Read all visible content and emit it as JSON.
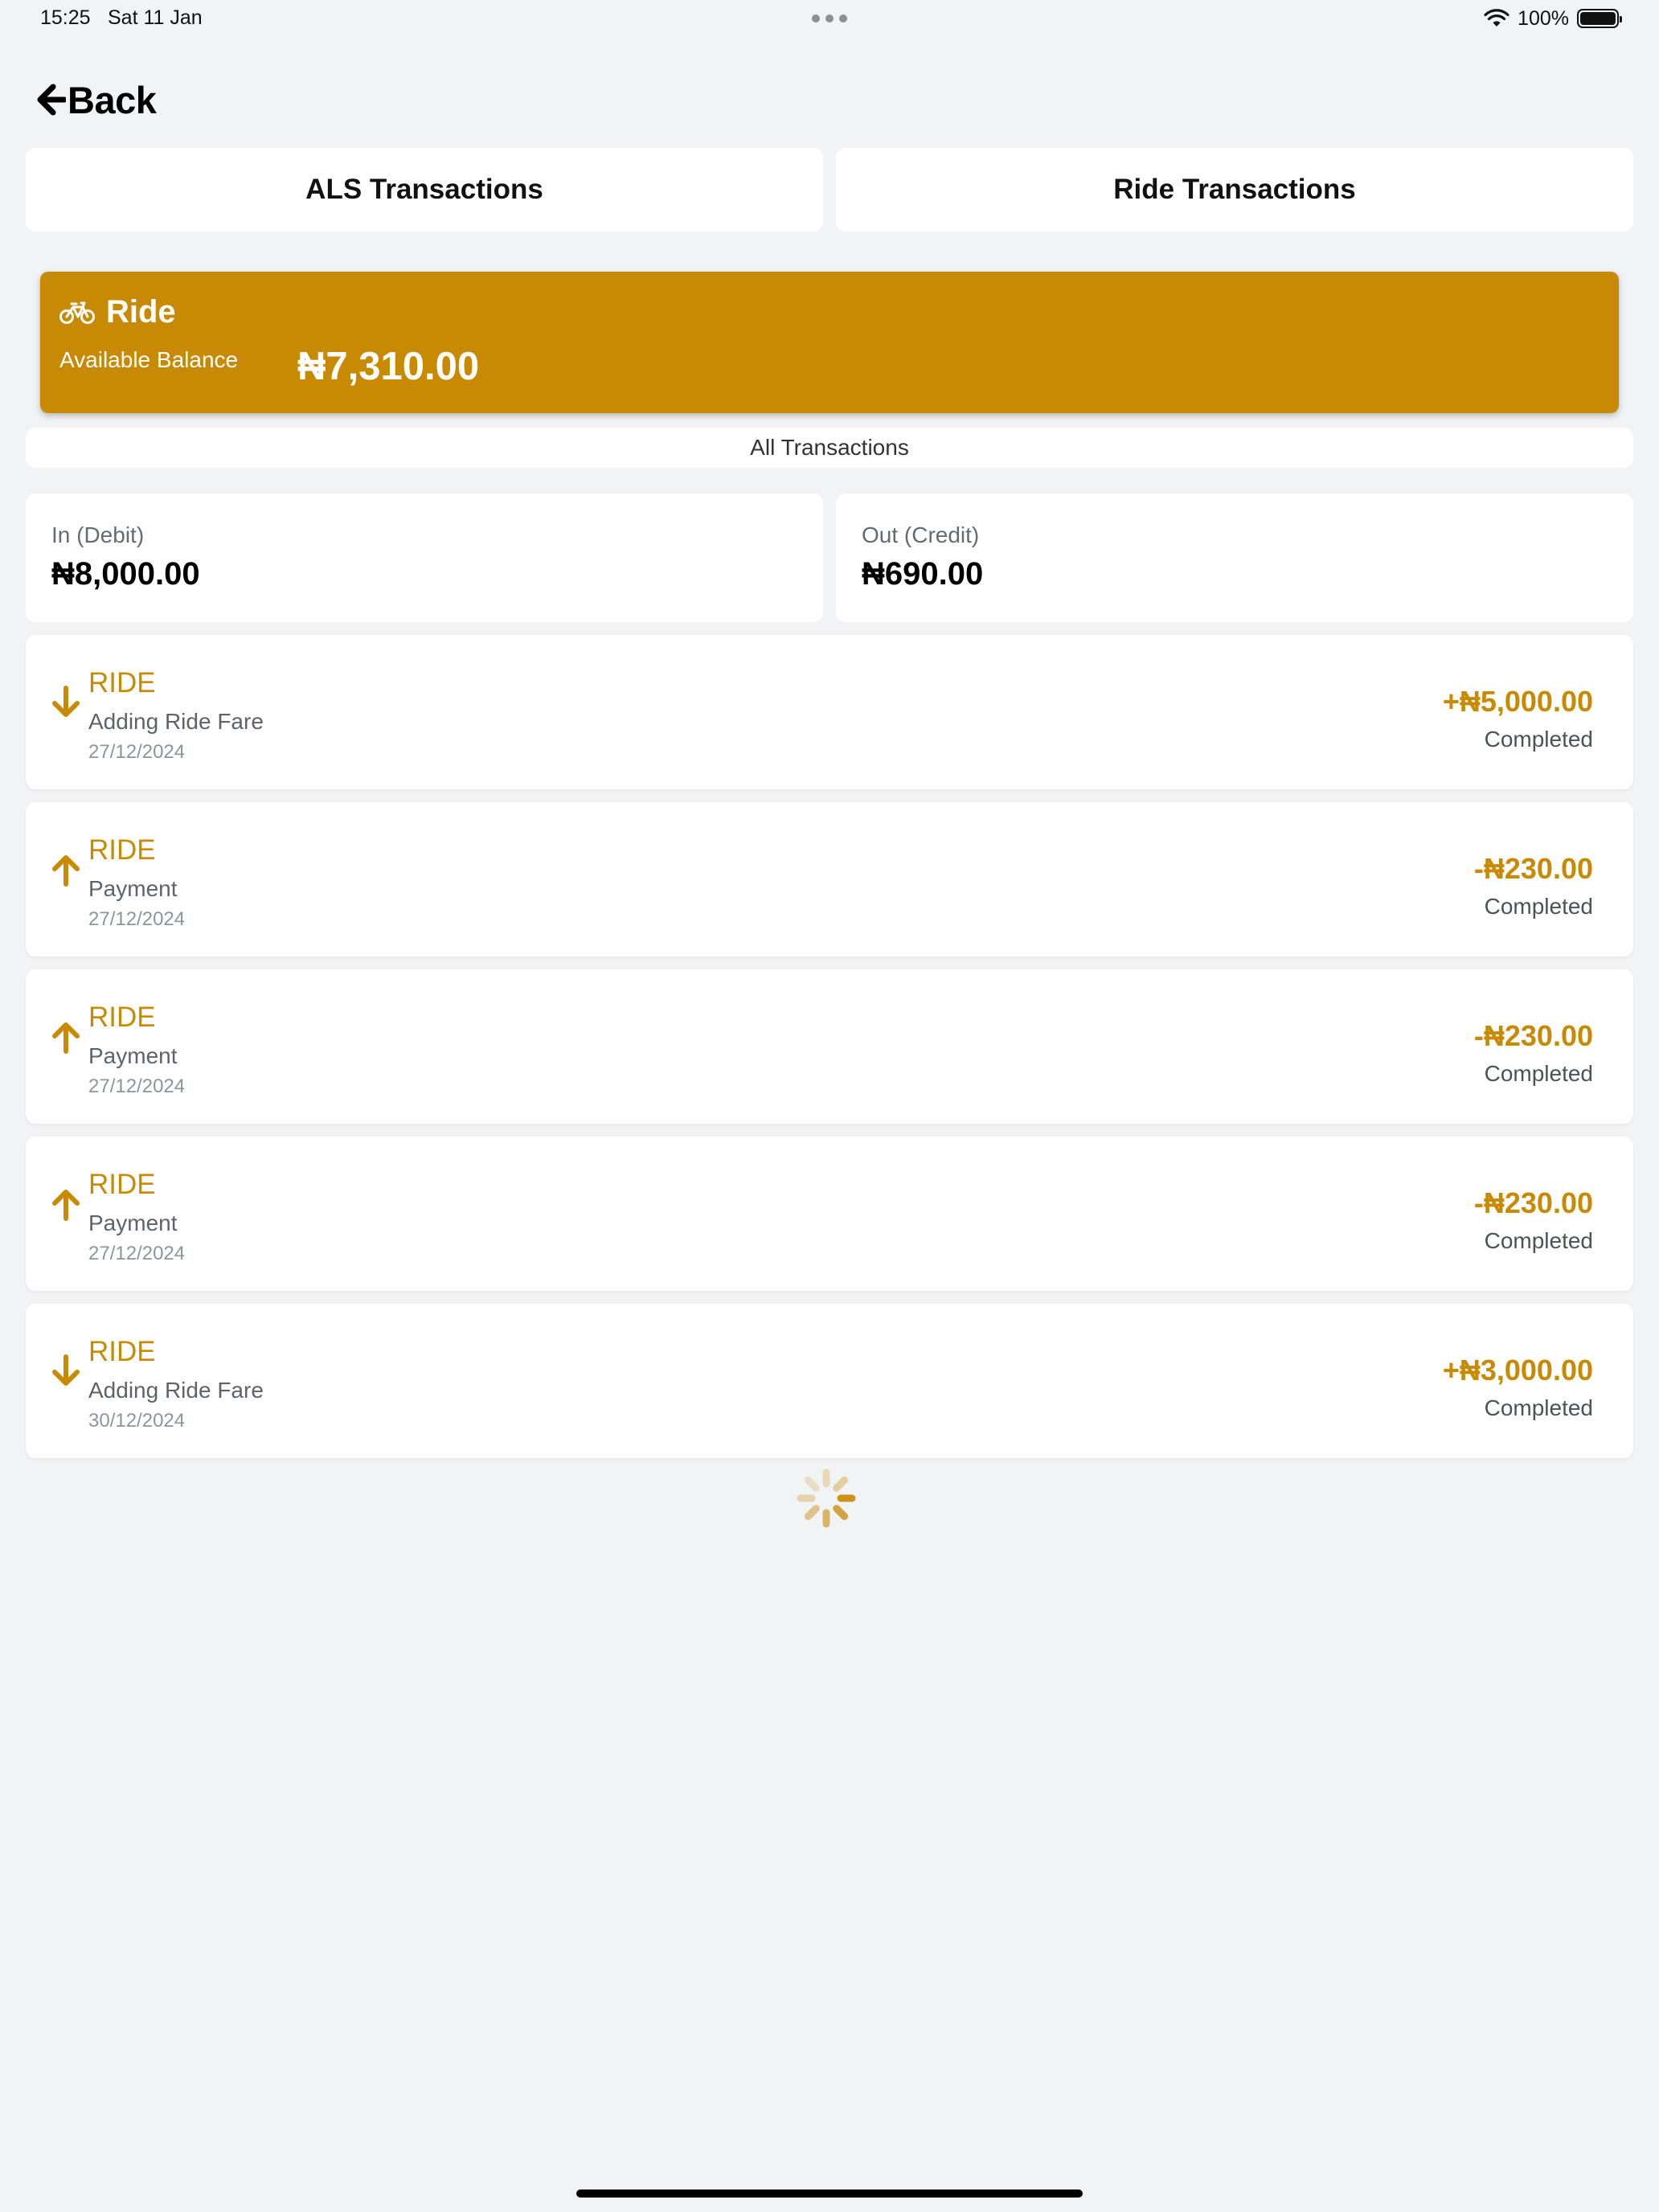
{
  "status_bar": {
    "time": "15:25",
    "date": "Sat 11 Jan",
    "battery_pct": "100%",
    "battery_level": 1.0
  },
  "nav": {
    "back_label": "Back"
  },
  "tabs": [
    {
      "label": "ALS Transactions"
    },
    {
      "label": "Ride Transactions"
    }
  ],
  "balance": {
    "title": "Ride",
    "label": "Available Balance",
    "amount": "₦7,310.00",
    "icon": "bicycle-icon"
  },
  "filter": {
    "label": "All Transactions"
  },
  "summary": {
    "in_label": "In (Debit)",
    "in_value": "₦8,000.00",
    "out_label": "Out (Credit)",
    "out_value": "₦690.00"
  },
  "transactions": [
    {
      "type": "RIDE",
      "description": "Adding Ride Fare",
      "date": "27/12/2024",
      "amount": "+₦5,000.00",
      "status": "Completed",
      "direction": "down"
    },
    {
      "type": "RIDE",
      "description": "Payment",
      "date": "27/12/2024",
      "amount": "-₦230.00",
      "status": "Completed",
      "direction": "up"
    },
    {
      "type": "RIDE",
      "description": "Payment",
      "date": "27/12/2024",
      "amount": "-₦230.00",
      "status": "Completed",
      "direction": "up"
    },
    {
      "type": "RIDE",
      "description": "Payment",
      "date": "27/12/2024",
      "amount": "-₦230.00",
      "status": "Completed",
      "direction": "up"
    },
    {
      "type": "RIDE",
      "description": "Adding Ride Fare",
      "date": "30/12/2024",
      "amount": "+₦3,000.00",
      "status": "Completed",
      "direction": "down"
    }
  ],
  "colors": {
    "accent": "#c98a03",
    "background": "#f2f3f5",
    "card": "#ffffff"
  }
}
